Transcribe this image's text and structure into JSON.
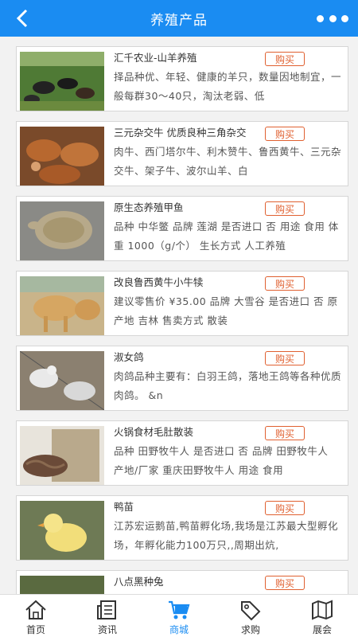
{
  "header": {
    "title": "养殖产品"
  },
  "buy_label": "购买",
  "products": [
    {
      "name": "汇千农业-山羊养殖",
      "desc": "择品种优、年轻、健康的羊只，数量因地制宜，一般每群30～40只，淘汰老弱、低"
    },
    {
      "name": "三元杂交牛 优质良种三角杂交",
      "desc": "肉牛、西门塔尔牛、利木赞牛、鲁西黄牛、三元杂交牛、架子牛、波尔山羊、白"
    },
    {
      "name": "原生态养殖甲鱼",
      "desc": "品种 中华鳖 品牌 莲湖 是否进口 否 用途 食用 体重 1000（g/个） 生长方式 人工养殖"
    },
    {
      "name": "改良鲁西黄牛小牛犊",
      "desc": "建议零售价 ¥35.00 品牌 大雪谷 是否进口 否 原产地 吉林 售卖方式 散装"
    },
    {
      "name": "淑女鸽",
      "desc": "肉鸽品种主要有：白羽王鸽，落地王鸽等各种优质肉鸽。 &n"
    },
    {
      "name": "火锅食材毛肚散装",
      "desc": "品种 田野牧牛人 是否进口 否 品牌 田野牧牛人 产地/厂家 重庆田野牧牛人 用途 食用"
    },
    {
      "name": "鸭苗",
      "desc": "江苏宏运鹅苗,鸭苗孵化场,我场是江苏最大型孵化场，年孵化能力100万只,,周期出炕,"
    },
    {
      "name": "八点黑种兔",
      "desc": ""
    }
  ],
  "tabs": [
    {
      "label": "首页",
      "icon": "home-icon"
    },
    {
      "label": "资讯",
      "icon": "news-icon"
    },
    {
      "label": "商城",
      "icon": "cart-icon"
    },
    {
      "label": "求购",
      "icon": "tag-icon"
    },
    {
      "label": "展会",
      "icon": "map-icon"
    }
  ],
  "colors": {
    "primary": "#1a8cf2",
    "buy": "#e06030"
  }
}
